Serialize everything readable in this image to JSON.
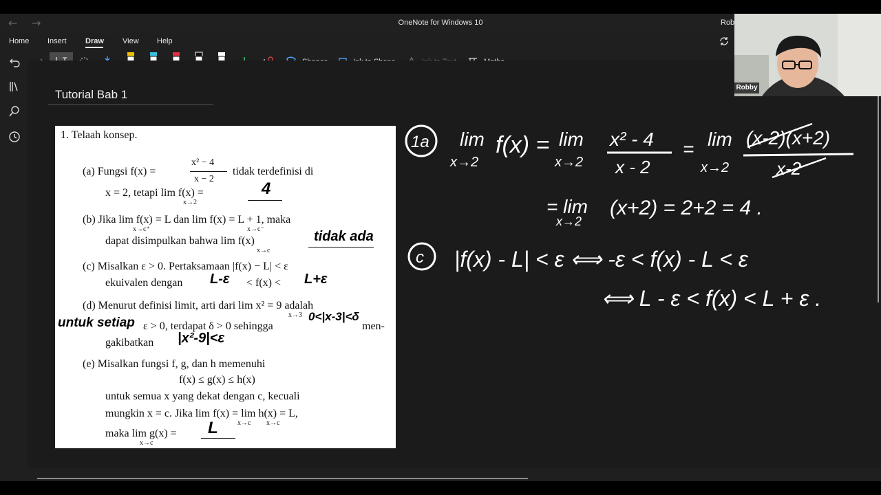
{
  "window": {
    "title": "OneNote for Windows 10",
    "user_partial": "Rob"
  },
  "menu": {
    "tabs": [
      "Home",
      "Insert",
      "Draw",
      "View",
      "Help"
    ],
    "active": "Draw"
  },
  "toolbar": {
    "shapes_label": "Shapes",
    "ink_to_shape_label": "Ink to Shape",
    "ink_to_text_label": "Ink to Text",
    "maths_label": "Maths",
    "pen_colors": [
      "#f0c000",
      "#3ac0e0",
      "#e03040",
      "#ffffff",
      "#ffffff"
    ]
  },
  "page": {
    "title": "Tutorial Bab 1"
  },
  "webcam": {
    "name": "Robby"
  },
  "document": {
    "heading": "1.  Telaah konsep.",
    "a_1": "(a)  Fungsi f(x) =",
    "a_frac_num": "x² − 4",
    "a_frac_den": "x − 2",
    "a_1b": "tidak terdefinisi di",
    "a_2": "x = 2, tetapi lim f(x) =",
    "a_2_sub": "x→2",
    "a_answer": "4",
    "b_1": "(b)  Jika  lim  f(x) = L dan  lim  f(x) = L + 1, maka",
    "b_1_sub1": "x→c⁺",
    "b_1_sub2": "x→c⁻",
    "b_2": "dapat disimpulkan bahwa lim f(x)",
    "b_2_sub": "x→c",
    "b_answer": "tidak ada",
    "c_1": "(c)  Misalkan ε > 0.  Pertaksamaan |f(x) − L| < ε",
    "c_2a": "ekuivalen dengan",
    "c_2b": "< f(x) <",
    "c_answer1": "L-ε",
    "c_answer2": "L+ε",
    "d_1": "(d)  Menurut definisi limit, arti dari lim x² = 9 adalah",
    "d_1_sub": "x→3",
    "d_handwritten_left": "untuk setiap",
    "d_2": "ε > 0, terdapat δ > 0 sehingga",
    "d_2_end": "men-",
    "d_handwritten_mid": "0<|x-3|<δ",
    "d_3": "gakibatkan",
    "d_answer": "|x²-9|<ε",
    "e_1": "(e)  Misalkan fungsi f, g, dan h memenuhi",
    "e_2": "f(x) ≤ g(x) ≤ h(x)",
    "e_3": "untuk semua x yang dekat dengan c, kecuali",
    "e_4": "mungkin x = c.  Jika lim f(x) = lim h(x) = L,",
    "e_4_sub": "x→c         x→c",
    "e_5": "maka lim g(x) =",
    "e_5_sub": "x→c",
    "e_answer": "L"
  },
  "ink_notes": {
    "label_1a": "1a",
    "line1_lim": "lim",
    "line1_sub": "x→2",
    "line1_fx": "f(x) =",
    "line1_lim2": "lim",
    "line1_sub2": "x→2",
    "line1_frac_num": "x² - 4",
    "line1_frac_den": "x - 2",
    "line1_eq": "=",
    "line1_lim3": "lim",
    "line1_sub3": "x→2",
    "line1_frac2_num": "(x-2)(x+2)",
    "line1_frac2_den": "x-2",
    "line2_eq": "= lim",
    "line2_sub": "x→2",
    "line2_rest": "(x+2) = 2+2 = 4 .",
    "label_c": "c",
    "line3": "|f(x) - L| < ε ⟺ -ε < f(x) - L < ε",
    "line4": "⟺  L - ε < f(x) < L + ε ."
  }
}
